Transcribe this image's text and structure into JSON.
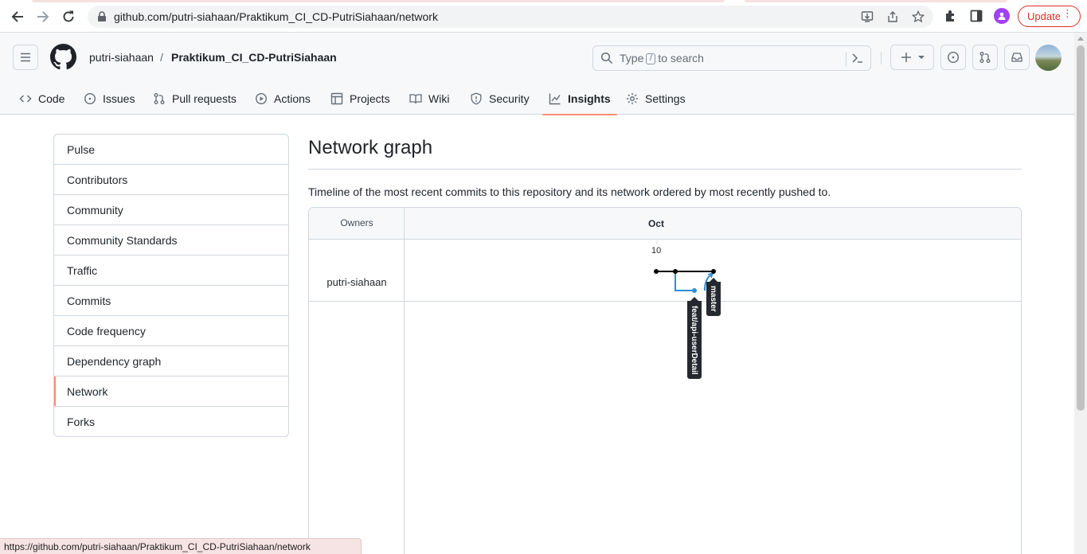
{
  "browser": {
    "url": "github.com/putri-siahaan/Praktikum_CI_CD-PutriSiahaan/network",
    "update_label": "Update"
  },
  "header": {
    "owner": "putri-siahaan",
    "separator": "/",
    "repo": "Praktikum_CI_CD-PutriSiahaan",
    "search_prefix": "Type",
    "search_key": "/",
    "search_suffix": "to search"
  },
  "tabs": [
    {
      "label": "Code",
      "icon": "code-icon"
    },
    {
      "label": "Issues",
      "icon": "issue-icon"
    },
    {
      "label": "Pull requests",
      "icon": "pull-request-icon"
    },
    {
      "label": "Actions",
      "icon": "play-icon"
    },
    {
      "label": "Projects",
      "icon": "table-icon"
    },
    {
      "label": "Wiki",
      "icon": "book-icon"
    },
    {
      "label": "Security",
      "icon": "shield-icon"
    },
    {
      "label": "Insights",
      "icon": "graph-icon",
      "active": true
    },
    {
      "label": "Settings",
      "icon": "gear-icon"
    }
  ],
  "sidebar": {
    "items": [
      {
        "label": "Pulse"
      },
      {
        "label": "Contributors"
      },
      {
        "label": "Community"
      },
      {
        "label": "Community Standards"
      },
      {
        "label": "Traffic"
      },
      {
        "label": "Commits"
      },
      {
        "label": "Code frequency"
      },
      {
        "label": "Dependency graph"
      },
      {
        "label": "Network",
        "selected": true
      },
      {
        "label": "Forks"
      }
    ]
  },
  "main": {
    "title": "Network graph",
    "description": "Timeline of the most recent commits to this repository and its network ordered by most recently pushed to."
  },
  "network": {
    "owners_label": "Owners",
    "month": "Oct",
    "day": "10",
    "owner": "putri-siahaan",
    "branches": [
      {
        "name": "master",
        "color": "#000000"
      },
      {
        "name": "feat/api-userDetail",
        "color": "#2b8ed8"
      }
    ]
  },
  "status_bar": {
    "text": "https://github.com/putri-siahaan/Praktikum_CI_CD-PutriSiahaan/network"
  },
  "colors": {
    "accent": "#fd8c73",
    "branch_blue": "#2b8ed8",
    "update_red": "#d93025"
  }
}
